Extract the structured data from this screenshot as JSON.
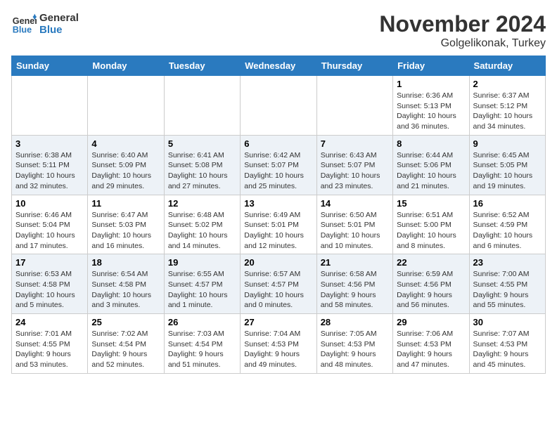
{
  "header": {
    "logo_line1": "General",
    "logo_line2": "Blue",
    "month_title": "November 2024",
    "location": "Golgelikonak, Turkey"
  },
  "weekdays": [
    "Sunday",
    "Monday",
    "Tuesday",
    "Wednesday",
    "Thursday",
    "Friday",
    "Saturday"
  ],
  "weeks": [
    [
      {
        "day": "",
        "info": ""
      },
      {
        "day": "",
        "info": ""
      },
      {
        "day": "",
        "info": ""
      },
      {
        "day": "",
        "info": ""
      },
      {
        "day": "",
        "info": ""
      },
      {
        "day": "1",
        "info": "Sunrise: 6:36 AM\nSunset: 5:13 PM\nDaylight: 10 hours and 36 minutes."
      },
      {
        "day": "2",
        "info": "Sunrise: 6:37 AM\nSunset: 5:12 PM\nDaylight: 10 hours and 34 minutes."
      }
    ],
    [
      {
        "day": "3",
        "info": "Sunrise: 6:38 AM\nSunset: 5:11 PM\nDaylight: 10 hours and 32 minutes."
      },
      {
        "day": "4",
        "info": "Sunrise: 6:40 AM\nSunset: 5:09 PM\nDaylight: 10 hours and 29 minutes."
      },
      {
        "day": "5",
        "info": "Sunrise: 6:41 AM\nSunset: 5:08 PM\nDaylight: 10 hours and 27 minutes."
      },
      {
        "day": "6",
        "info": "Sunrise: 6:42 AM\nSunset: 5:07 PM\nDaylight: 10 hours and 25 minutes."
      },
      {
        "day": "7",
        "info": "Sunrise: 6:43 AM\nSunset: 5:07 PM\nDaylight: 10 hours and 23 minutes."
      },
      {
        "day": "8",
        "info": "Sunrise: 6:44 AM\nSunset: 5:06 PM\nDaylight: 10 hours and 21 minutes."
      },
      {
        "day": "9",
        "info": "Sunrise: 6:45 AM\nSunset: 5:05 PM\nDaylight: 10 hours and 19 minutes."
      }
    ],
    [
      {
        "day": "10",
        "info": "Sunrise: 6:46 AM\nSunset: 5:04 PM\nDaylight: 10 hours and 17 minutes."
      },
      {
        "day": "11",
        "info": "Sunrise: 6:47 AM\nSunset: 5:03 PM\nDaylight: 10 hours and 16 minutes."
      },
      {
        "day": "12",
        "info": "Sunrise: 6:48 AM\nSunset: 5:02 PM\nDaylight: 10 hours and 14 minutes."
      },
      {
        "day": "13",
        "info": "Sunrise: 6:49 AM\nSunset: 5:01 PM\nDaylight: 10 hours and 12 minutes."
      },
      {
        "day": "14",
        "info": "Sunrise: 6:50 AM\nSunset: 5:01 PM\nDaylight: 10 hours and 10 minutes."
      },
      {
        "day": "15",
        "info": "Sunrise: 6:51 AM\nSunset: 5:00 PM\nDaylight: 10 hours and 8 minutes."
      },
      {
        "day": "16",
        "info": "Sunrise: 6:52 AM\nSunset: 4:59 PM\nDaylight: 10 hours and 6 minutes."
      }
    ],
    [
      {
        "day": "17",
        "info": "Sunrise: 6:53 AM\nSunset: 4:58 PM\nDaylight: 10 hours and 5 minutes."
      },
      {
        "day": "18",
        "info": "Sunrise: 6:54 AM\nSunset: 4:58 PM\nDaylight: 10 hours and 3 minutes."
      },
      {
        "day": "19",
        "info": "Sunrise: 6:55 AM\nSunset: 4:57 PM\nDaylight: 10 hours and 1 minute."
      },
      {
        "day": "20",
        "info": "Sunrise: 6:57 AM\nSunset: 4:57 PM\nDaylight: 10 hours and 0 minutes."
      },
      {
        "day": "21",
        "info": "Sunrise: 6:58 AM\nSunset: 4:56 PM\nDaylight: 9 hours and 58 minutes."
      },
      {
        "day": "22",
        "info": "Sunrise: 6:59 AM\nSunset: 4:56 PM\nDaylight: 9 hours and 56 minutes."
      },
      {
        "day": "23",
        "info": "Sunrise: 7:00 AM\nSunset: 4:55 PM\nDaylight: 9 hours and 55 minutes."
      }
    ],
    [
      {
        "day": "24",
        "info": "Sunrise: 7:01 AM\nSunset: 4:55 PM\nDaylight: 9 hours and 53 minutes."
      },
      {
        "day": "25",
        "info": "Sunrise: 7:02 AM\nSunset: 4:54 PM\nDaylight: 9 hours and 52 minutes."
      },
      {
        "day": "26",
        "info": "Sunrise: 7:03 AM\nSunset: 4:54 PM\nDaylight: 9 hours and 51 minutes."
      },
      {
        "day": "27",
        "info": "Sunrise: 7:04 AM\nSunset: 4:53 PM\nDaylight: 9 hours and 49 minutes."
      },
      {
        "day": "28",
        "info": "Sunrise: 7:05 AM\nSunset: 4:53 PM\nDaylight: 9 hours and 48 minutes."
      },
      {
        "day": "29",
        "info": "Sunrise: 7:06 AM\nSunset: 4:53 PM\nDaylight: 9 hours and 47 minutes."
      },
      {
        "day": "30",
        "info": "Sunrise: 7:07 AM\nSunset: 4:53 PM\nDaylight: 9 hours and 45 minutes."
      }
    ]
  ]
}
